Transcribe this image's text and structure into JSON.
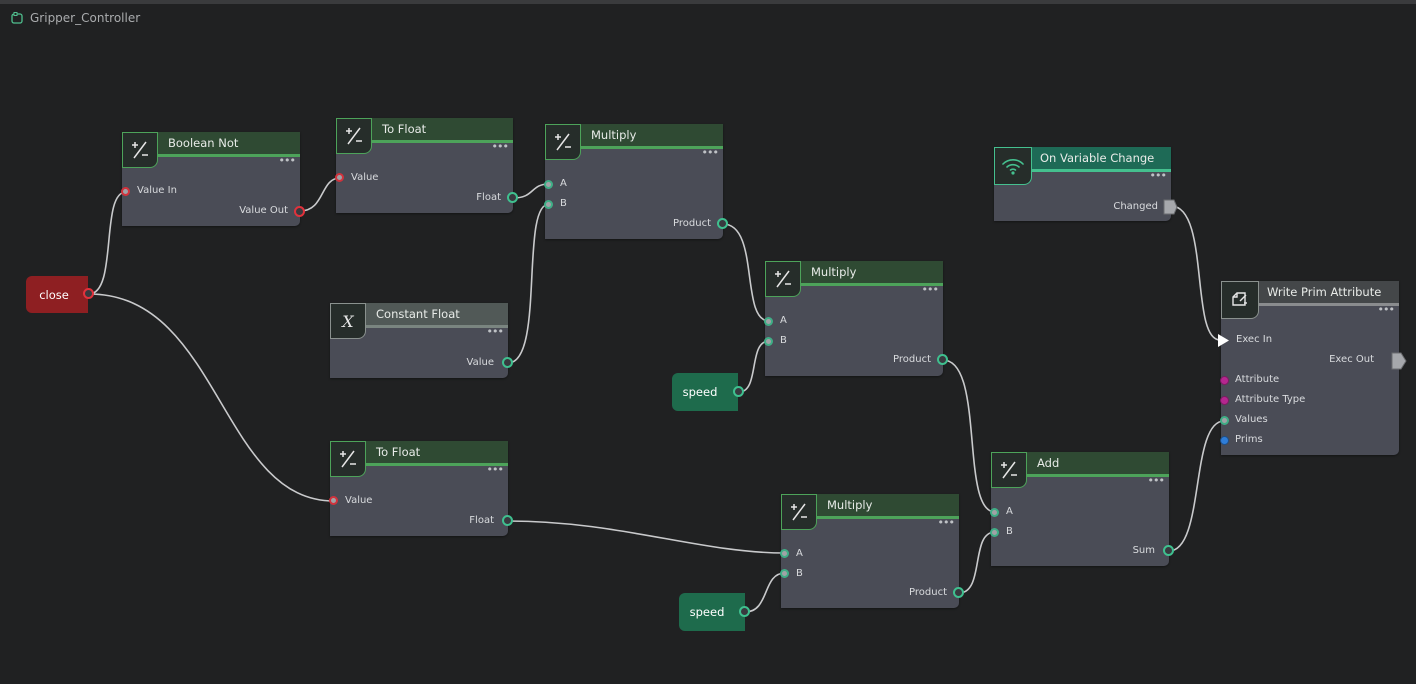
{
  "graph_title": "Gripper_Controller",
  "nodes": {
    "boolean_not": {
      "title": "Boolean Not",
      "icon": "math-operator-icon",
      "in": "Value In",
      "out": "Value Out"
    },
    "to_float_1": {
      "title": "To Float",
      "icon": "math-operator-icon",
      "in": "Value",
      "out": "Float"
    },
    "multiply_1": {
      "title": "Multiply",
      "icon": "math-operator-icon",
      "a": "A",
      "b": "B",
      "out": "Product"
    },
    "constant_float": {
      "title": "Constant Float",
      "icon": "variable-x-icon",
      "icon_glyph": "X",
      "out": "Value"
    },
    "multiply_2": {
      "title": "Multiply",
      "icon": "math-operator-icon",
      "a": "A",
      "b": "B",
      "out": "Product"
    },
    "to_float_2": {
      "title": "To Float",
      "icon": "math-operator-icon",
      "in": "Value",
      "out": "Float"
    },
    "multiply_3": {
      "title": "Multiply",
      "icon": "math-operator-icon",
      "a": "A",
      "b": "B",
      "out": "Product"
    },
    "add": {
      "title": "Add",
      "icon": "math-operator-icon",
      "a": "A",
      "b": "B",
      "out": "Sum"
    },
    "on_variable_change": {
      "title": "On Variable Change",
      "icon": "signal-broadcast-icon",
      "out": "Changed"
    },
    "write_prim_attribute": {
      "title": "Write Prim Attribute",
      "icon": "prim-write-icon",
      "exec_in": "Exec In",
      "exec_out": "Exec Out",
      "attribute": "Attribute",
      "attribute_type": "Attribute Type",
      "values": "Values",
      "prims": "Prims"
    }
  },
  "variables": {
    "close": "close",
    "speed_1": "speed",
    "speed_2": "speed"
  },
  "more_glyph": "•••",
  "colors": {
    "background": "#202122",
    "node_body": "#4a4c56",
    "header_green": "#2f4a33",
    "accent_green": "#4da35a",
    "header_teal": "#1e6a56",
    "bool_port": "#e0323c",
    "float_port": "#3fc08f",
    "wire": "#c9cacc",
    "close_var": "#8e1f22",
    "speed_var": "#1e6b4c"
  }
}
